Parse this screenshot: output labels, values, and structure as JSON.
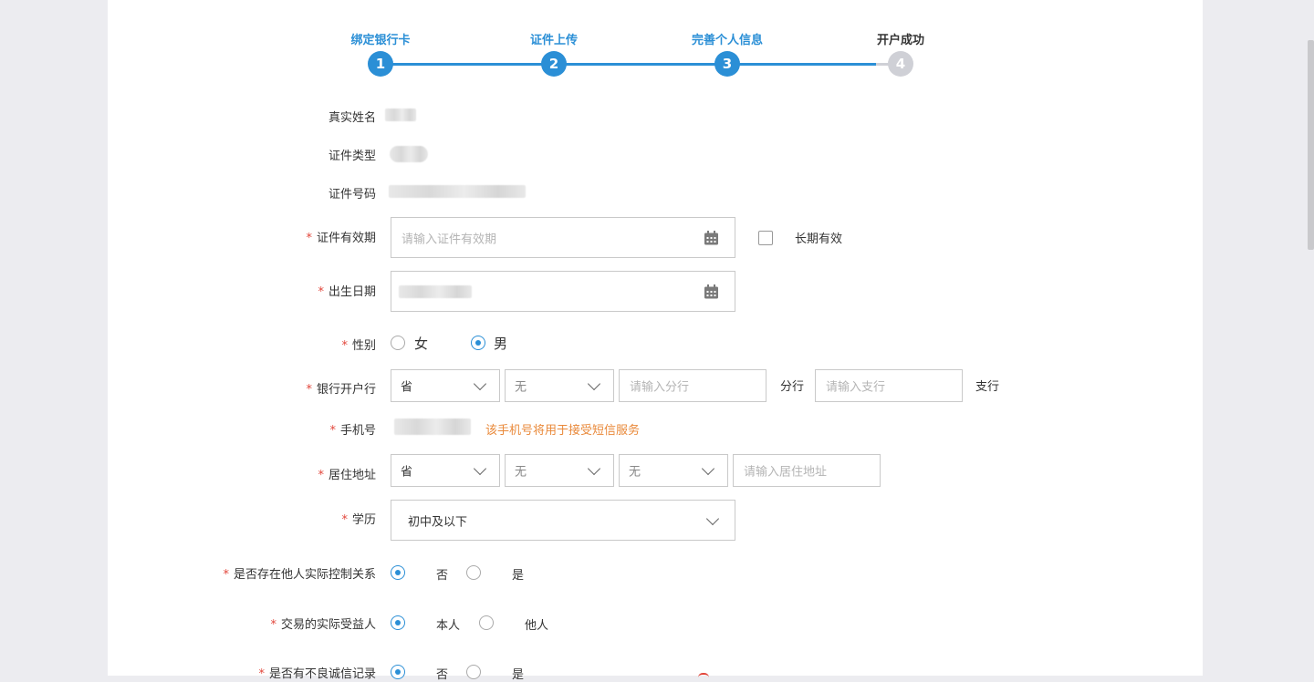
{
  "steps": [
    {
      "label": "绑定银行卡",
      "num": "1"
    },
    {
      "label": "证件上传",
      "num": "2"
    },
    {
      "label": "完善个人信息",
      "num": "3"
    },
    {
      "label": "开户成功",
      "num": "4"
    }
  ],
  "form": {
    "real_name": {
      "label": "真实姓名"
    },
    "id_type": {
      "label": "证件类型"
    },
    "id_number": {
      "label": "证件号码"
    },
    "id_validity": {
      "label": "证件有效期",
      "placeholder": "请输入证件有效期",
      "long_term": "长期有效"
    },
    "birth_date": {
      "label": "出生日期"
    },
    "gender": {
      "label": "性别",
      "female": "女",
      "male": "男",
      "selected": "男"
    },
    "bank": {
      "label": "银行开户行",
      "province": "省",
      "city": "无",
      "branch_placeholder": "请输入分行",
      "branch_suffix": "分行",
      "sub_placeholder": "请输入支行",
      "sub_suffix": "支行"
    },
    "phone": {
      "label": "手机号",
      "hint": "该手机号将用于接受短信服务"
    },
    "address": {
      "label": "居住地址",
      "province": "省",
      "city": "无",
      "district": "无",
      "placeholder": "请输入居住地址"
    },
    "education": {
      "label": "学历",
      "value": "初中及以下"
    },
    "control": {
      "label": "是否存在他人实际控制关系",
      "no": "否",
      "yes": "是",
      "selected": "否"
    },
    "beneficiary": {
      "label": "交易的实际受益人",
      "self": "本人",
      "other": "他人",
      "selected": "本人"
    },
    "credit": {
      "label": "是否有不良诚信记录",
      "no": "否",
      "yes": "是",
      "selected": "否"
    }
  },
  "colors": {
    "primary": "#2b8fd6",
    "required": "#e2463b",
    "hint": "#e9893a",
    "pending": "#cfd0d6"
  }
}
